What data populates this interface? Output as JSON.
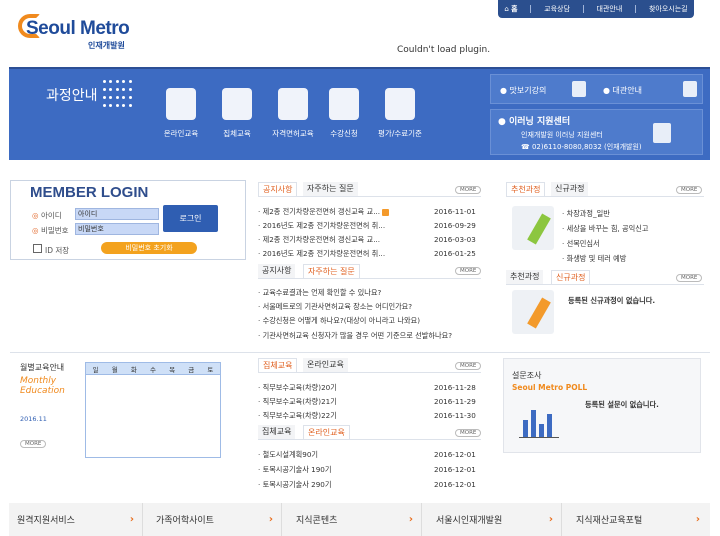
{
  "topnav": {
    "items": [
      "홈",
      "교육상담",
      "대관안내",
      "찾아오시는길"
    ]
  },
  "logo": {
    "text": "Seoul Metro",
    "sub": "인재개발원"
  },
  "plugin": {
    "message": "Couldn't load plugin."
  },
  "hero": {
    "title": "과정안내",
    "menu": [
      "온라인교육",
      "집체교육",
      "자격면허교육",
      "수강신청",
      "평가/수료기준"
    ],
    "right": {
      "preview": "맛보기강의",
      "rental": "대관안내",
      "center_title": "이러닝 지원센터",
      "center_line": "인재개발원 이러닝 지원센터",
      "center_tel": "☎ 02)6110-8080,8032 (인재개발원)"
    }
  },
  "login": {
    "title": "MEMBER LOGIN",
    "id_label": "아이디",
    "pw_label": "비밀번호",
    "id_value": "아이디",
    "pw_value": "비밀번호",
    "login_button": "로그인",
    "save_id": "ID 저장",
    "reset_button": "비밀번호 초기화"
  },
  "notice": {
    "tabs": [
      "공지사항",
      "자주하는 질문"
    ],
    "more": "MORE",
    "items": [
      {
        "title": "제2종 전기차량운전면허 갱신교육 교...",
        "date": "2016-11-01"
      },
      {
        "title": "2016년도 제2종 전기차량운전면허 취...",
        "date": "2016-09-29"
      },
      {
        "title": "제2종 전기차량운전면허 갱신교육 교...",
        "date": "2016-03-03"
      },
      {
        "title": "2016년도 제2종 전기차량운전면허 취...",
        "date": "2016-01-25"
      }
    ]
  },
  "faq": {
    "tabs": [
      "공지사항",
      "자주하는 질문"
    ],
    "more": "MORE",
    "items": [
      "교육수료결과는 언제 확인할 수 있나요?",
      "서울메트로의 기관사면허교육 장소는 어디인가요?",
      "수강신청은 어떻게 하나요?(대상이 아니라고 나와요)",
      "기관사면허교육 신청자가 많을 경우 어떤 기준으로 선발하나요?"
    ]
  },
  "recommend": {
    "tabs": [
      "추천과정",
      "신규과정"
    ],
    "more": "MORE",
    "items": [
      "차장과정_일반",
      "세상을 바꾸는 힘, 공익신고",
      "선목민심서",
      "화생방 및 테러 예방"
    ]
  },
  "newcourse": {
    "tabs": [
      "추천과정",
      "신규과정"
    ],
    "more": "MORE",
    "message": "등록된 신규과정이 없습니다."
  },
  "monthly": {
    "title": "월별교육안내",
    "en": "Monthly Education",
    "date": "2016.11",
    "more": "MORE",
    "days": [
      "일",
      "월",
      "화",
      "수",
      "목",
      "금",
      "토"
    ]
  },
  "collective": {
    "tabs": [
      "집체교육",
      "온라인교육"
    ],
    "more": "MORE",
    "items": [
      {
        "title": "직무보수교육(차량)20기",
        "date": "2016-11-28"
      },
      {
        "title": "직무보수교육(차량)21기",
        "date": "2016-11-29"
      },
      {
        "title": "직무보수교육(차량)22기",
        "date": "2016-11-30"
      }
    ]
  },
  "online": {
    "tabs": [
      "집체교육",
      "온라인교육"
    ],
    "more": "MORE",
    "items": [
      {
        "title": "철도시설계획90기",
        "date": "2016-12-01"
      },
      {
        "title": "토목시공기술사 190기",
        "date": "2016-12-01"
      },
      {
        "title": "토목시공기술사 290기",
        "date": "2016-12-01"
      }
    ]
  },
  "poll": {
    "title": "설문조사",
    "en": "Seoul Metro POLL",
    "message": "등록된 설문이 없습니다."
  },
  "bottom": {
    "items": [
      "원격지원서비스",
      "가족어학사이트",
      "지식콘텐츠",
      "서울시인재개발원",
      "지식재산교육포털"
    ]
  },
  "colors": {
    "primary": "#3d6bc2",
    "accent": "#f08a1e",
    "tab_active": "#e06020"
  }
}
